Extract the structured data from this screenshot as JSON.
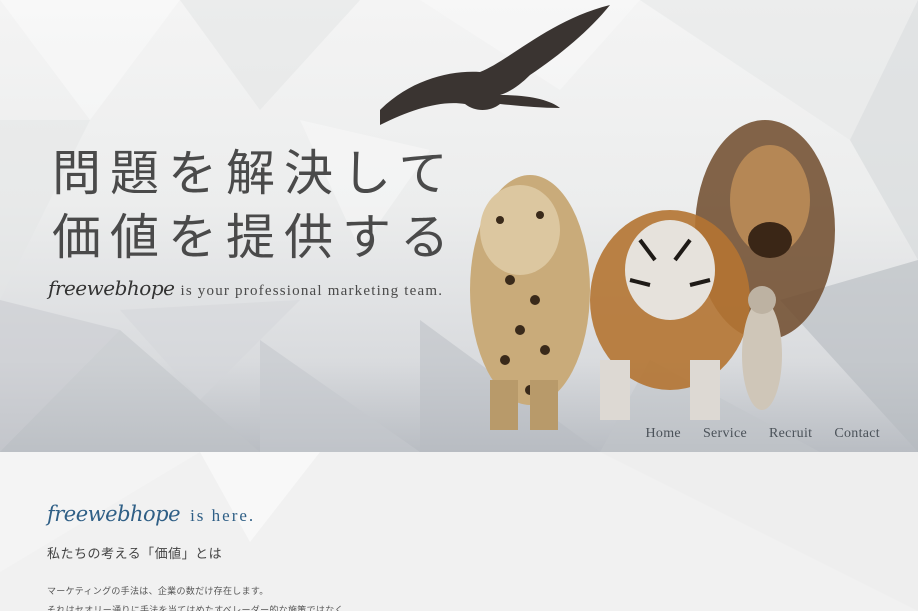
{
  "hero": {
    "headline_line1": "問題を解決して",
    "headline_line2": "価値を提供する",
    "brand": "freewebhope",
    "tagline": "is your professional marketing team."
  },
  "nav": {
    "items": [
      {
        "label": "Home"
      },
      {
        "label": "Service"
      },
      {
        "label": "Recruit"
      },
      {
        "label": "Contact"
      }
    ]
  },
  "about": {
    "brand": "freewebhope",
    "heading_suffix": "is here.",
    "subtitle": "私たちの考える「価値」とは",
    "line1": "マーケティングの手法は、企業の数だけ存在します。",
    "line2": "それはセオリー通りに手法を当てはめたすべレーダー的な施策ではなく"
  },
  "colors": {
    "headline": "#4a4a4a",
    "nav": "#4b5259",
    "brand_blue": "#2f5f86"
  }
}
